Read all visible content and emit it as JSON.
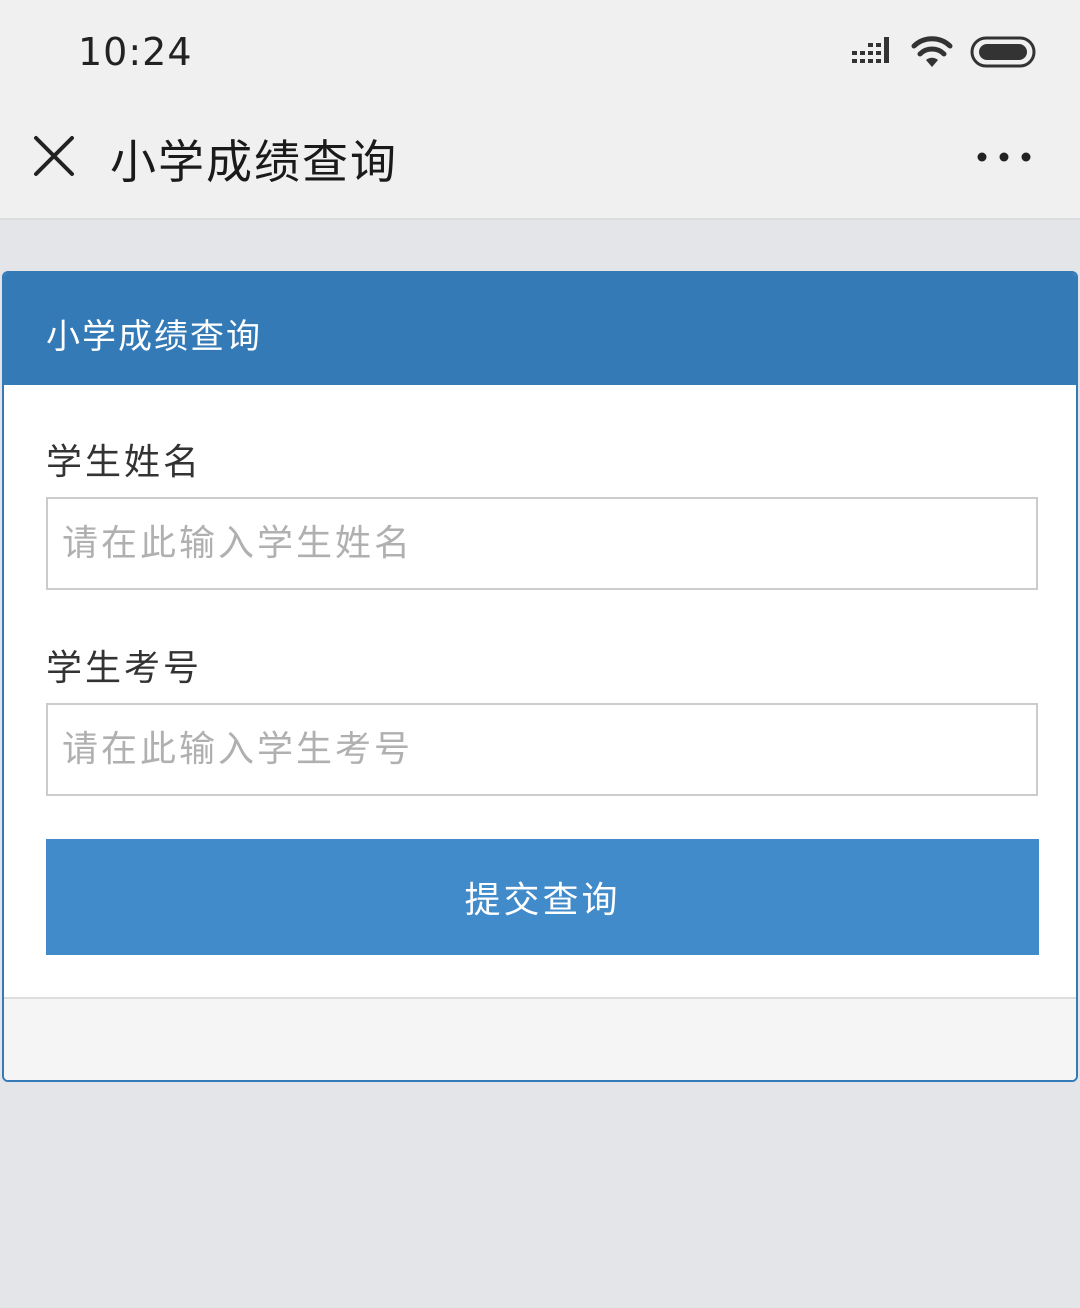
{
  "status_bar": {
    "time": "10:24",
    "icons": [
      "signal-icon",
      "wifi-icon",
      "battery-icon"
    ]
  },
  "nav": {
    "title": "小学成绩查询",
    "close_icon": "close-icon",
    "more_icon": "more-icon"
  },
  "panel": {
    "heading": "小学成绩查询",
    "fields": [
      {
        "label": "学生姓名",
        "placeholder": "请在此输入学生姓名",
        "value": ""
      },
      {
        "label": "学生考号",
        "placeholder": "请在此输入学生考号",
        "value": ""
      }
    ],
    "submit_label": "提交查询"
  },
  "colors": {
    "accent": "#337ab7",
    "button": "#428bca",
    "background": "#e4e5e9"
  }
}
